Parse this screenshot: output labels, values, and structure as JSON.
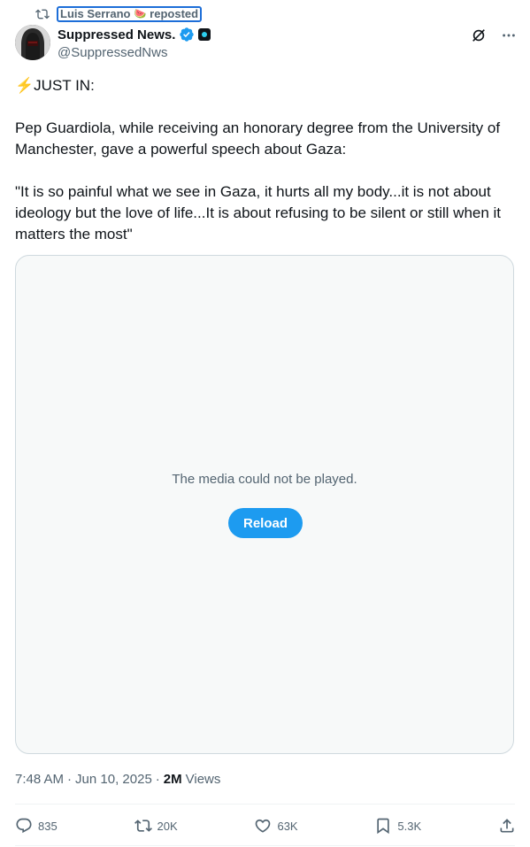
{
  "repost": {
    "user": "Luis Serrano",
    "emoji": "🍉",
    "suffix": "reposted"
  },
  "author": {
    "display_name": "Suppressed News.",
    "handle": "@SuppressedNws",
    "verified_icon": "verified-badge-icon",
    "affiliation_icon": "affiliation-badge-icon"
  },
  "tweet": {
    "line1_emoji": "⚡",
    "line1": "JUST IN:",
    "paragraph2": "Pep Guardiola, while receiving an honorary degree from the University of Manchester, gave a powerful speech about Gaza:",
    "paragraph3": "\"It is so painful what we see in Gaza, it hurts all my body...it is not about ideology but the love of life...It is about refusing to be silent or still when it matters the most\""
  },
  "media": {
    "message": "The media could not be played.",
    "reload_label": "Reload"
  },
  "meta": {
    "time": "7:48 AM",
    "sep1": "·",
    "date": "Jun 10, 2025",
    "sep2": "·",
    "views_count": "2M",
    "views_label": "Views"
  },
  "actions": {
    "replies": "835",
    "reposts": "20K",
    "likes": "63K",
    "bookmarks": "5.3K"
  },
  "colors": {
    "accent": "#1d9bf0",
    "secondary_text": "#536471",
    "primary_text": "#0f1419"
  }
}
